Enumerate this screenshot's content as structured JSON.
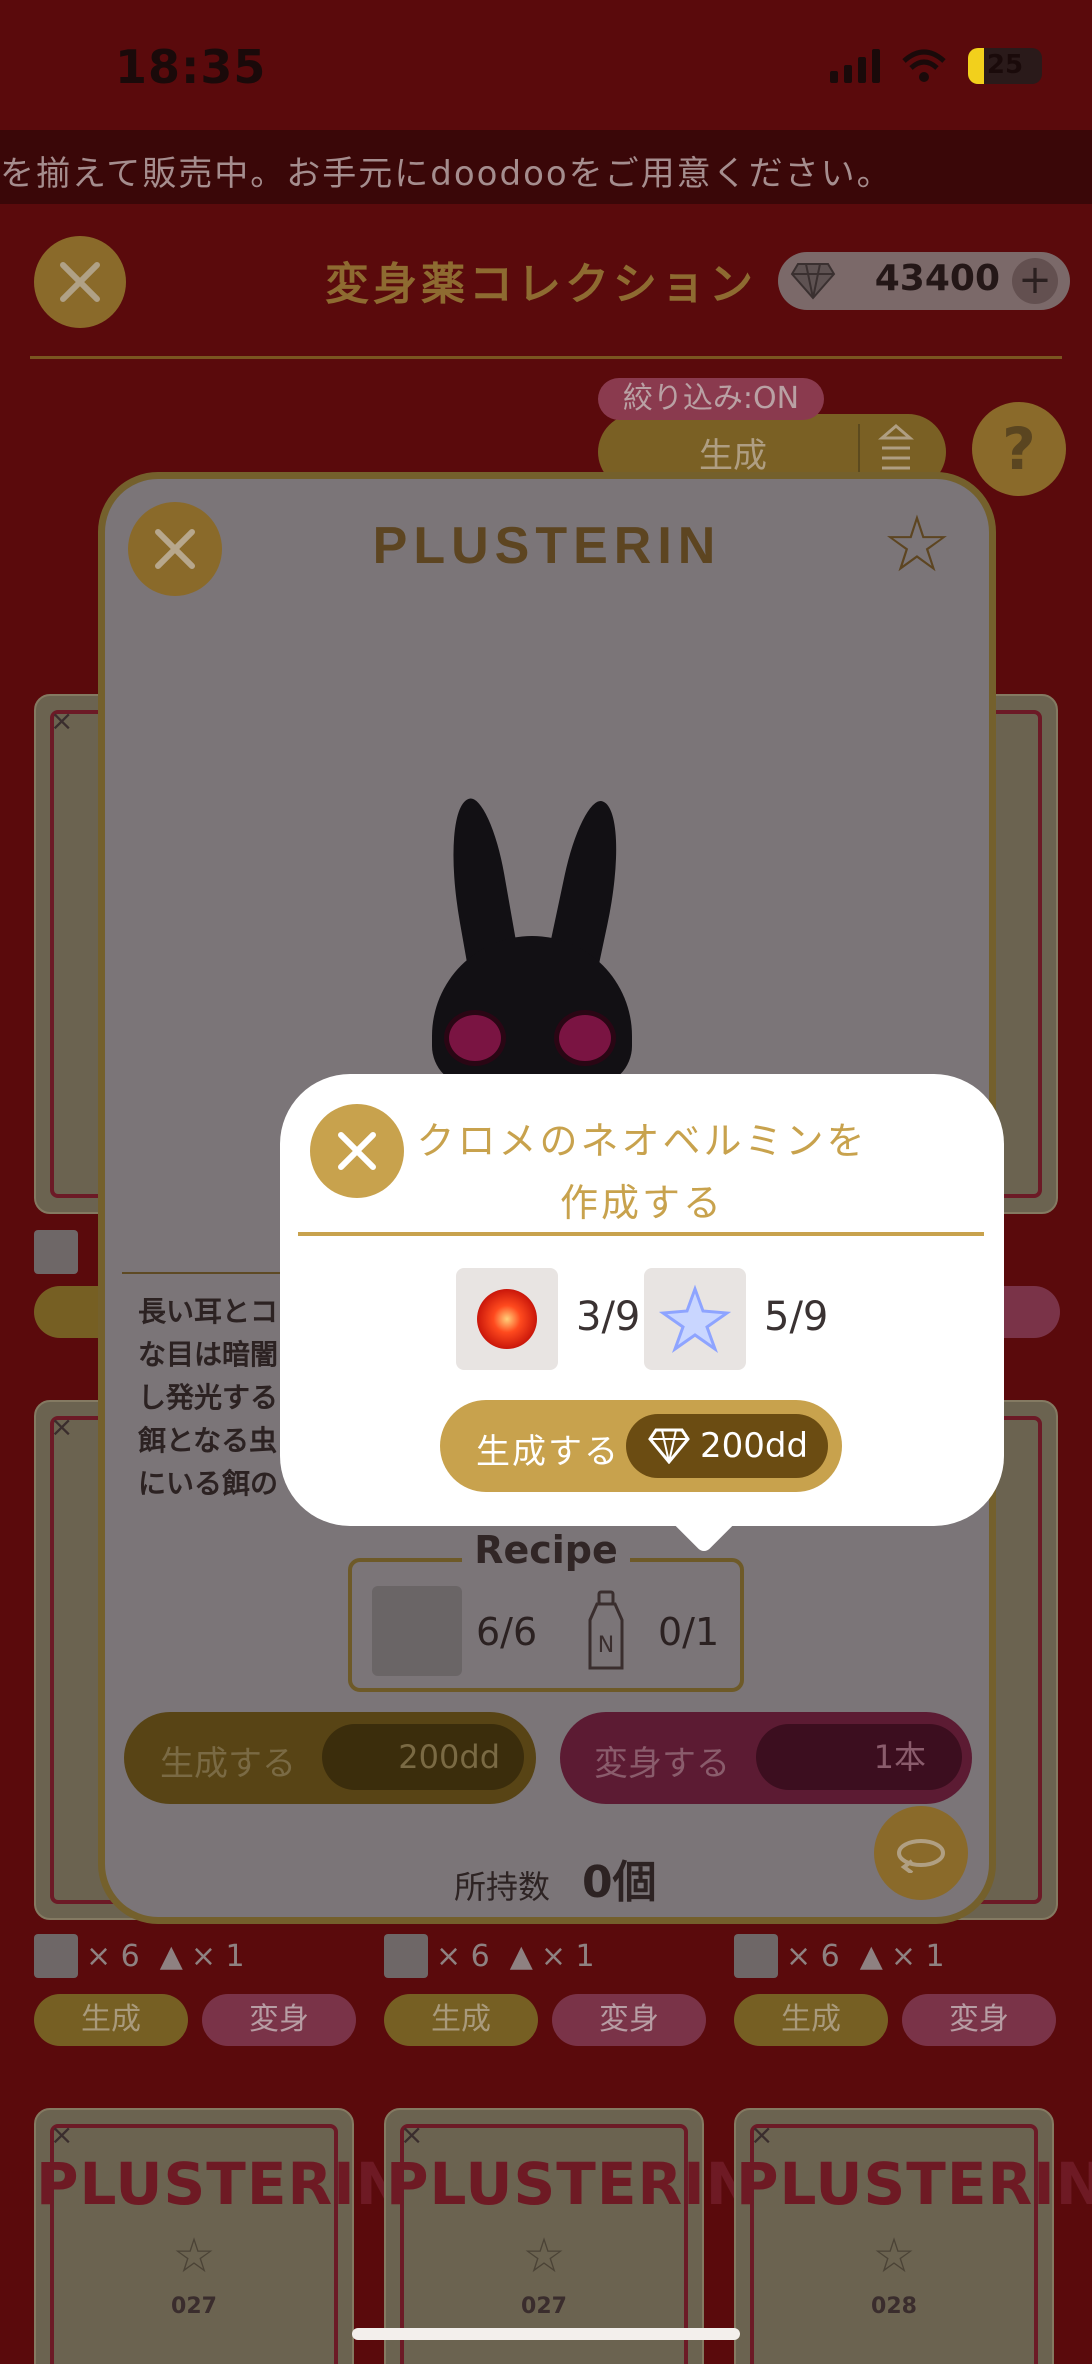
{
  "status_bar": {
    "time": "18:35",
    "battery": "25"
  },
  "ticker": {
    "text": "を揃えて販売中。お手元にdoodooをご用意ください。"
  },
  "header": {
    "title": "変身薬コレクション",
    "balance": "43400",
    "balance_plus": "+"
  },
  "filter": {
    "badge": "絞り込み:ON",
    "sort_label": "生成",
    "help": "?"
  },
  "background_cards": {
    "logo": "PLUSTERIN",
    "close": "×",
    "numbers": [
      "027",
      "027",
      "028"
    ],
    "row_counts": {
      "x6": "× 6",
      "x1": "× 1"
    },
    "gen_label": "生成",
    "trans_label": "変身"
  },
  "detail": {
    "title": "PLUSTERIN",
    "description": [
      "長い耳とコ",
      "な目は暗闇",
      "し発光する",
      "餌となる虫",
      "にいる餌の"
    ],
    "recipe": {
      "title": "Recipe",
      "item1_count": "6/6",
      "item2_count": "0/1"
    },
    "create_button": {
      "label": "生成する",
      "cost": "200dd"
    },
    "transform_button": {
      "label": "変身する",
      "cost": "1本"
    },
    "owned_label": "所持数",
    "owned_value": "0個"
  },
  "popup": {
    "title_line1": "クロメのネオベルミンを",
    "title_line2": "作成する",
    "ingredients": [
      {
        "icon": "red-orb-icon",
        "count": "3/9"
      },
      {
        "icon": "blue-star-icon",
        "count": "5/9"
      }
    ],
    "create_label": "生成する",
    "cost": "200dd"
  },
  "colors": {
    "gold": "#c8a24d",
    "crimson": "#5a0a0c",
    "dark_gold": "#6b4c12"
  }
}
